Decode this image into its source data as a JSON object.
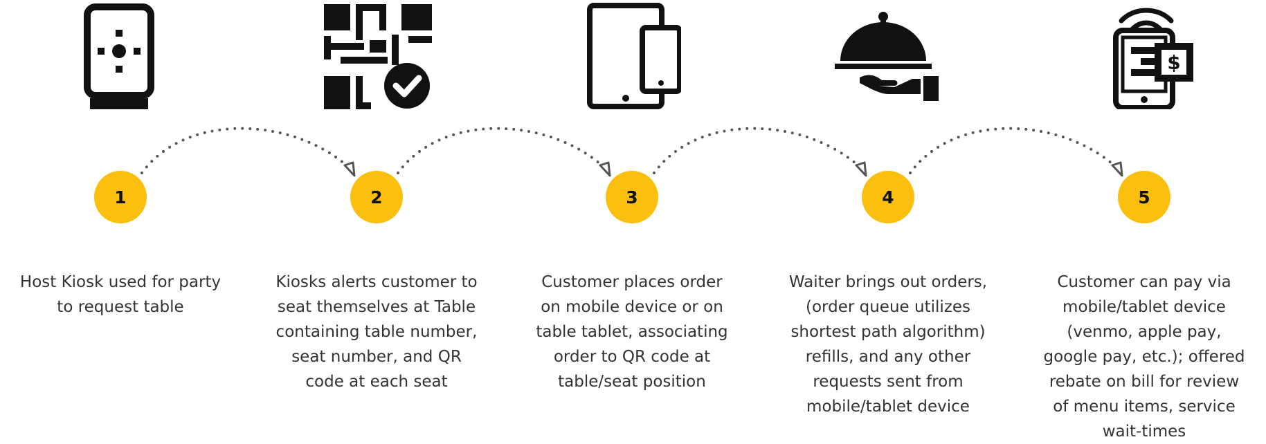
{
  "steps": [
    {
      "number": "1",
      "icon": "kiosk-icon",
      "text": "Host Kiosk used for party\nto request table"
    },
    {
      "number": "2",
      "icon": "qr-code-check-icon",
      "text": "Kiosks alerts customer to\nseat themselves at Table\ncontaining table number,\nseat number, and QR\ncode at each seat"
    },
    {
      "number": "3",
      "icon": "tablet-phone-icon",
      "text": "Customer places order\non mobile device or on\ntable tablet, associating\norder to QR code at\ntable/seat position"
    },
    {
      "number": "4",
      "icon": "serving-cloche-icon",
      "text": "Waiter brings out orders,\n(order queue utilizes\nshortest path algorithm)\nrefills, and any other\nrequests sent from\nmobile/tablet device"
    },
    {
      "number": "5",
      "icon": "mobile-payment-icon",
      "text": "Customer can pay via\nmobile/tablet device\n(venmo, apple pay,\ngoogle pay, etc.); offered\nrebate on bill for review\nof menu items, service\nwait-times"
    }
  ],
  "colors": {
    "badge": "#fbbf0f",
    "icon": "#111111",
    "connector": "#555555",
    "text": "#333333"
  }
}
